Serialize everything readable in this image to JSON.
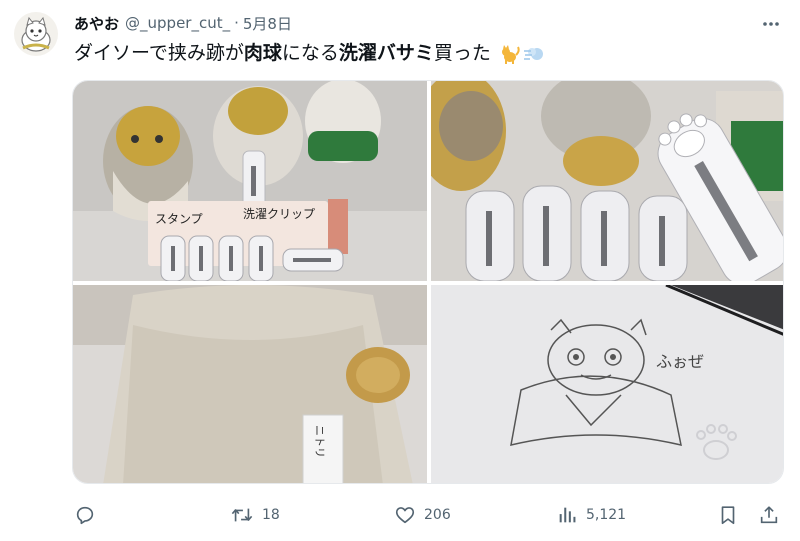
{
  "tweet": {
    "display_name": "あやお",
    "handle": "@_upper_cut_",
    "separator": "·",
    "date": "5月8日",
    "text_part1": "ダイソーで挟み跡が",
    "text_bold1": "肉球",
    "text_part2": "になる",
    "text_bold2": "洗濯バサミ",
    "text_part3": "買った",
    "emojis": [
      "cat-emoji",
      "dash-emoji"
    ]
  },
  "media": {
    "photo1": {
      "sign_left": "スタンプ",
      "sign_right": "洗濯クリップ"
    },
    "photo3": {
      "tag_text": "ニトリ"
    },
    "photo4": {
      "handwritten_text": "ふぉぜ"
    }
  },
  "actions": {
    "reply_count": "",
    "retweet_count": "18",
    "like_count": "206",
    "views_count": "5,121"
  },
  "colors": {
    "text_primary": "#0f1419",
    "text_secondary": "#536471",
    "border": "#e6e9ec"
  }
}
